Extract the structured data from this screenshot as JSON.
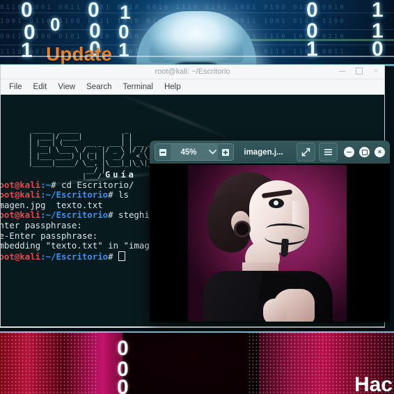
{
  "banner_top": {
    "headline": "Update",
    "binary_digits": [
      "0",
      "0",
      "1",
      "0",
      "0",
      "0",
      "0",
      "1",
      "0",
      "1",
      "0",
      "0",
      "1",
      "1",
      "1",
      "0",
      "0",
      "0"
    ],
    "binary_rows": [
      "0110 1001 0011 1101 0110 0010 1110 0101 1001 0100 0111 0010",
      "1001 0110 1100 0011 1010 0101 0110 1110 0011 1001 0101 1100",
      "0011 1100 0101 1010 0110 1001 1100 0011 0101 1110 1001 0110",
      "1110 0011 1001 0110 0101 1100 0011 1010 1001 0110 1100 0011"
    ]
  },
  "banner_bottom": {
    "headline": "Hac",
    "digits": [
      "0",
      "0",
      "0"
    ]
  },
  "terminal": {
    "title": "root@kali: ~/Escritorio",
    "menu": [
      "File",
      "Edit",
      "View",
      "Search",
      "Terminal",
      "Help"
    ],
    "window_buttons": {
      "minimize": "minimize",
      "maximize": "maximize",
      "close": "×"
    },
    "ascii_art": " _____  _____            _                           \n|  ___|/ ____|          | |                          \n| |__ | (___   __ _  ___| | __ ___    ___ ___  _ __  \n|  __| \\___ \\ / _` |/ _ \\ |/ // __|  / __/ _ \\| '  \\ \n| |___ ____) | (_| |  __/   < \\__ \\ | (_| (_) | |  | |\n|_____|_____/ \\__, |\\___|_|\\_\\|___/  \\___\\___/|_|  |_|\n               __/ |                                  \n              |___/                                   ",
    "guia_label": "Guía",
    "lines": [
      {
        "id": "l1",
        "prompt_user": "root@kali",
        "prompt_path": ":~",
        "prompt_sym": "# ",
        "command": "cd Escritorio/"
      },
      {
        "id": "l2",
        "prompt_user": "root@kali",
        "prompt_path": ":~/Escritorio",
        "prompt_sym": "# ",
        "command": "ls"
      },
      {
        "id": "l3",
        "output_files": "imagen.jpg  texto.txt"
      },
      {
        "id": "l4",
        "prompt_user": "root@kali",
        "prompt_path": ":~/Escritorio",
        "prompt_sym": "# ",
        "command": "steghid"
      },
      {
        "id": "l5",
        "output": "Enter passphrase:"
      },
      {
        "id": "l6",
        "output": "Re-Enter passphrase:"
      },
      {
        "id": "l7",
        "output": "embedding \"texto.txt\" in \"image"
      },
      {
        "id": "l8",
        "prompt_user": "root@kali",
        "prompt_path": ":~/Escritorio",
        "prompt_sym": "# ",
        "command": ""
      }
    ]
  },
  "viewer": {
    "zoom_level": "45%",
    "zoom_out_icon": "minus-square-icon",
    "zoom_in_icon": "plus-square-icon",
    "dropdown_icon": "chevron-down-icon",
    "title": "imagen.j...",
    "fullscreen_icon": "fullscreen-icon",
    "menu_icon": "hamburger-menu-icon",
    "window_buttons": {
      "minimize": "−",
      "maximize": "□",
      "close": "×"
    },
    "photo_alt": "anonymous-mask-portrait"
  },
  "colors": {
    "terminal_bg": "#071a1d",
    "prompt_red": "#e5484d",
    "prompt_blue": "#3b8eea",
    "viewer_bar": "#2c4c50",
    "accent_orange": "#e8812a",
    "banner_blue": "#0a4b7e",
    "banner_magenta": "#b5123a"
  }
}
